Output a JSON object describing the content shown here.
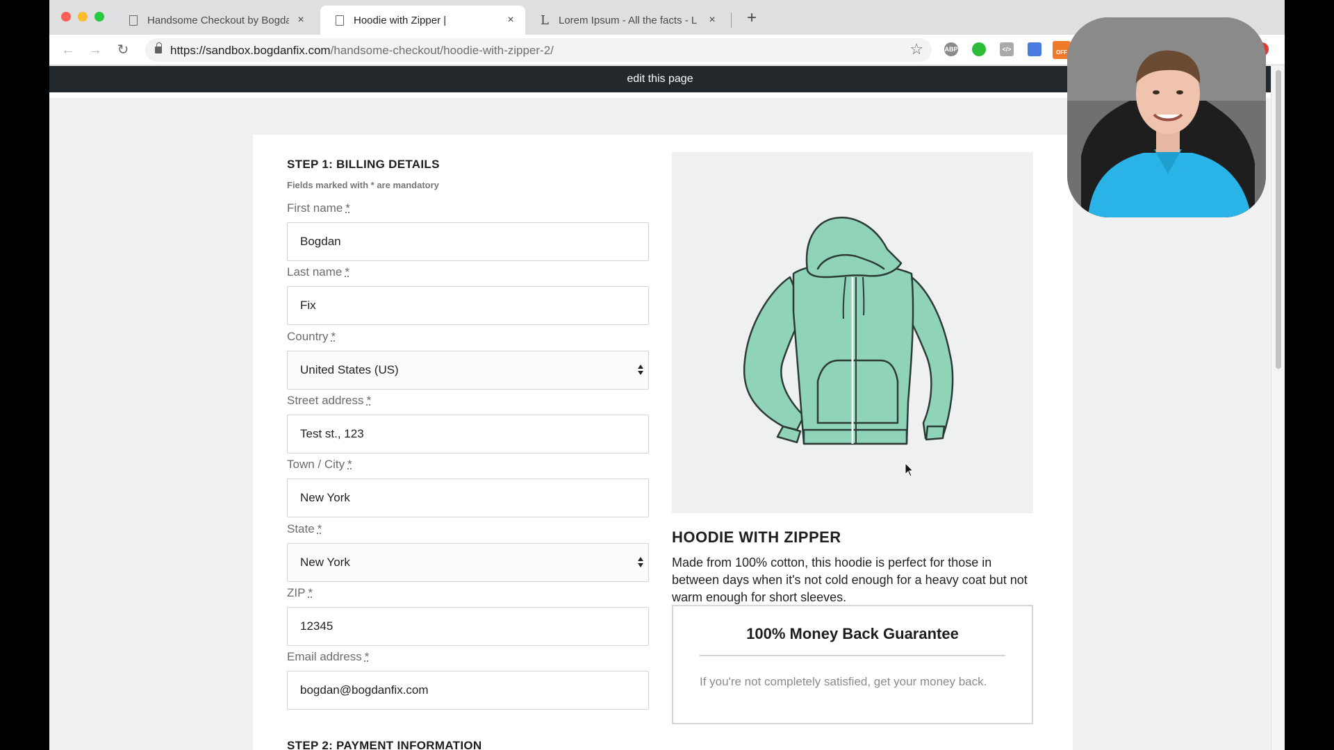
{
  "browser": {
    "tabs": [
      {
        "title": "Handsome Checkout by Bogda",
        "icon": "document-icon",
        "active": false
      },
      {
        "title": "Hoodie with Zipper |",
        "icon": "document-icon",
        "active": true
      },
      {
        "title": "Lorem Ipsum - All the facts - L",
        "icon": "lorem-ipsum-favicon",
        "active": false
      }
    ],
    "new_tab": "+",
    "close_glyph": "×",
    "url_host": "https://sandbox.bogdanfix.com",
    "url_path": "/handsome-checkout/hoodie-with-zipper-2/",
    "extensions": [
      {
        "name": "adblock-plus-icon",
        "label": "ABP"
      },
      {
        "name": "green-extension-icon",
        "label": ""
      },
      {
        "name": "code-extension-icon",
        "label": "</>"
      },
      {
        "name": "blue-extension-icon",
        "label": ""
      },
      {
        "name": "off-extension-icon",
        "label": "OFF"
      },
      {
        "name": "red-extension-icon",
        "label": ""
      }
    ]
  },
  "adminbar": {
    "edit_label": "edit this page"
  },
  "billing": {
    "step_title": "STEP 1: BILLING DETAILS",
    "mandatory_note": "Fields marked with * are mandatory",
    "required_mark": "*",
    "fields": [
      {
        "label": "First name",
        "value": "Bogdan",
        "type": "text"
      },
      {
        "label": "Last name",
        "value": "Fix",
        "type": "text"
      },
      {
        "label": "Country",
        "value": "United States (US)",
        "type": "select"
      },
      {
        "label": "Street address",
        "value": "Test st., 123",
        "type": "text"
      },
      {
        "label": "Town / City",
        "value": "New York",
        "type": "text"
      },
      {
        "label": "State",
        "value": "New York",
        "type": "select"
      },
      {
        "label": "ZIP",
        "value": "12345",
        "type": "text"
      },
      {
        "label": "Email address",
        "value": "bogdan@bogdanfix.com",
        "type": "text"
      }
    ],
    "step2_title": "STEP 2: PAYMENT INFORMATION"
  },
  "product": {
    "image_name": "hoodie-illustration",
    "title": "HOODIE WITH ZIPPER",
    "description": "Made from 100% cotton, this hoodie is perfect for those in between days when it's not cold enough for a heavy coat but not warm enough for short sleeves.",
    "guarantee_title": "100% Money Back Guarantee",
    "guarantee_text": "If you're not completely satisfied, get your money back."
  },
  "colors": {
    "hoodie": "#8fd3b9",
    "admin_bar": "#23282d",
    "webcam_shirt": "#2ab3e6"
  }
}
